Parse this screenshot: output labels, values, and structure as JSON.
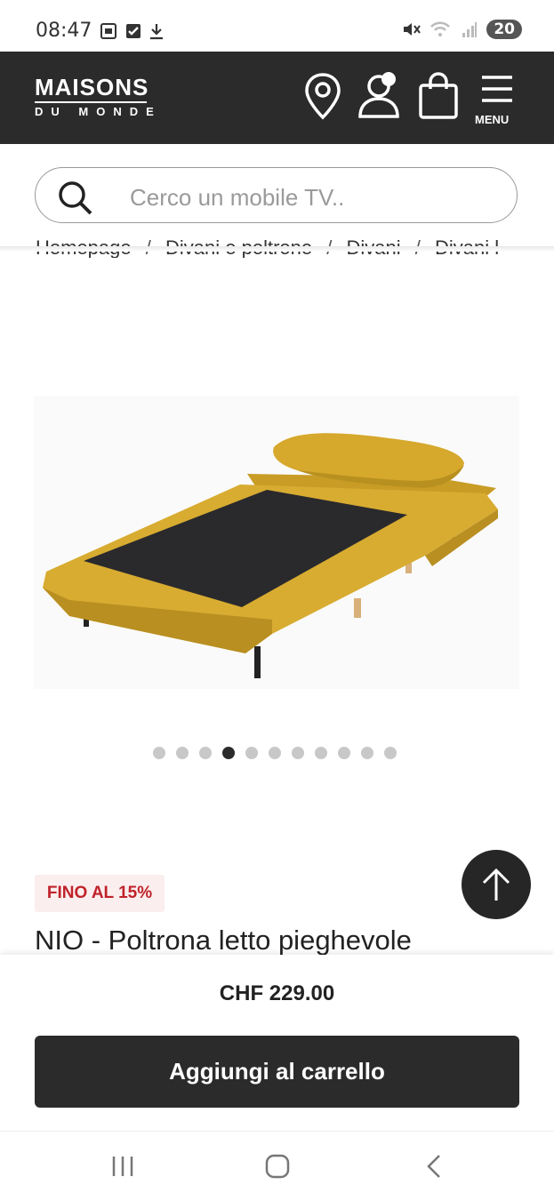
{
  "status_bar": {
    "time": "08:47",
    "battery": "20"
  },
  "header": {
    "logo_top": "MAISONS",
    "logo_bottom": "DU MONDE",
    "menu_label": "MENU",
    "icons": [
      "location-pin-icon",
      "user-icon",
      "shopping-bag-icon",
      "menu-icon"
    ]
  },
  "search": {
    "placeholder": "Cerco un mobile TV.."
  },
  "breadcrumb": [
    "Homepage",
    "/",
    "Divani e poltrone",
    "/",
    "Divani",
    "/",
    "Divani l"
  ],
  "gallery": {
    "dot_count": 11,
    "active_index": 3
  },
  "product": {
    "promo_badge": "FINO AL 15%",
    "title": "NIO - Poltrona letto pieghevole",
    "price": "CHF 229.00",
    "add_to_cart_label": "Aggiungi al carrello"
  },
  "colors": {
    "header_bg": "#2b2b2b",
    "promo_text": "#c0222a",
    "promo_bg": "#fbeeee",
    "product_fabric": "#d8ac31"
  }
}
